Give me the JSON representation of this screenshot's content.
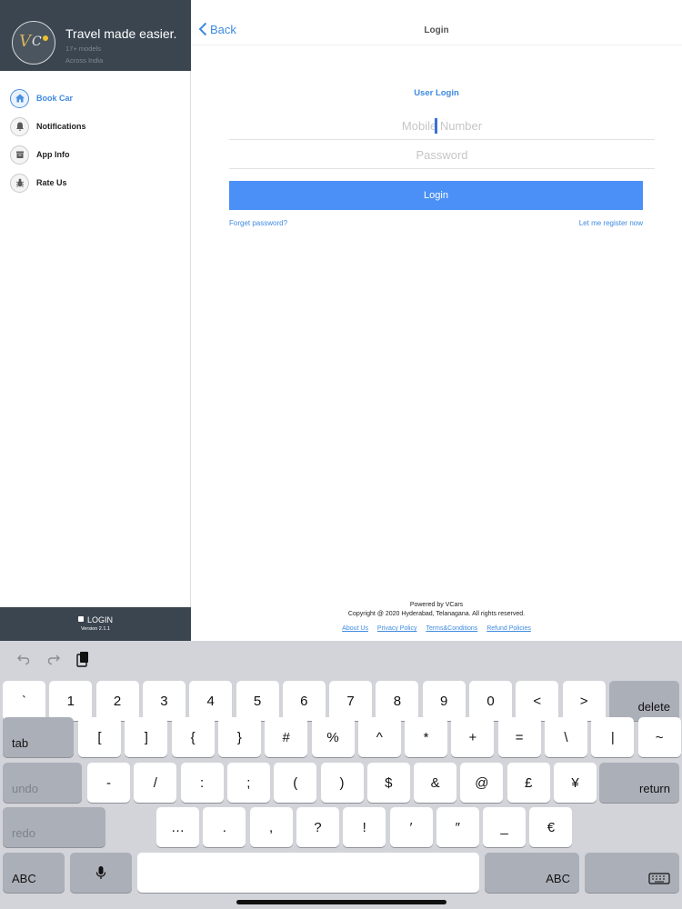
{
  "sidebar": {
    "logo_text": "VCars",
    "title": "Travel made easier.",
    "subtitle1": "17+ models",
    "subtitle2": "Across India",
    "items": [
      {
        "label": "Book Car",
        "icon": "home-icon",
        "active": true
      },
      {
        "label": "Notifications",
        "icon": "bell-icon",
        "active": false
      },
      {
        "label": "App Info",
        "icon": "archive-icon",
        "active": false
      },
      {
        "label": "Rate Us",
        "icon": "bug-icon",
        "active": false
      }
    ],
    "footer_login": "LOGIN",
    "footer_version": "Version 2.1.1"
  },
  "nav": {
    "back_label": "Back",
    "title": "Login"
  },
  "form": {
    "heading": "User Login",
    "mobile_placeholder": "Mobile Number",
    "password_placeholder": "Password",
    "login_label": "Login",
    "forgot_label": "Forget password?",
    "register_label": "Let me register now"
  },
  "footer": {
    "powered": "Powered by VCars",
    "copyright": "Copyright @ 2020 Hyderabad, Telanagana. All rights reserved.",
    "links": [
      "About Us",
      "Privacy Policy",
      "Terms&Conditions",
      "Refund Policies"
    ]
  },
  "keyboard": {
    "row1": [
      "`",
      "1",
      "2",
      "3",
      "4",
      "5",
      "6",
      "7",
      "8",
      "9",
      "0",
      "<",
      ">"
    ],
    "delete": "delete",
    "tab": "tab",
    "row2": [
      "[",
      "]",
      "{",
      "}",
      "#",
      "%",
      "^",
      "*",
      "+",
      "=",
      "\\",
      "|",
      "~"
    ],
    "undo": "undo",
    "row3": [
      "-",
      "/",
      ":",
      ";",
      "(",
      ")",
      "$",
      "&",
      "@",
      "£",
      "¥"
    ],
    "return": "return",
    "redo": "redo",
    "row4": [
      "…",
      ".",
      ",",
      "?",
      "!",
      "′",
      "″",
      "_",
      "€"
    ],
    "abc_left": "ABC",
    "abc_right": "ABC"
  },
  "colors": {
    "accent": "#3e8ae0",
    "button": "#4a90f6",
    "sidebar_header": "#3a4550",
    "keyboard_bg": "#d2d4d9"
  }
}
